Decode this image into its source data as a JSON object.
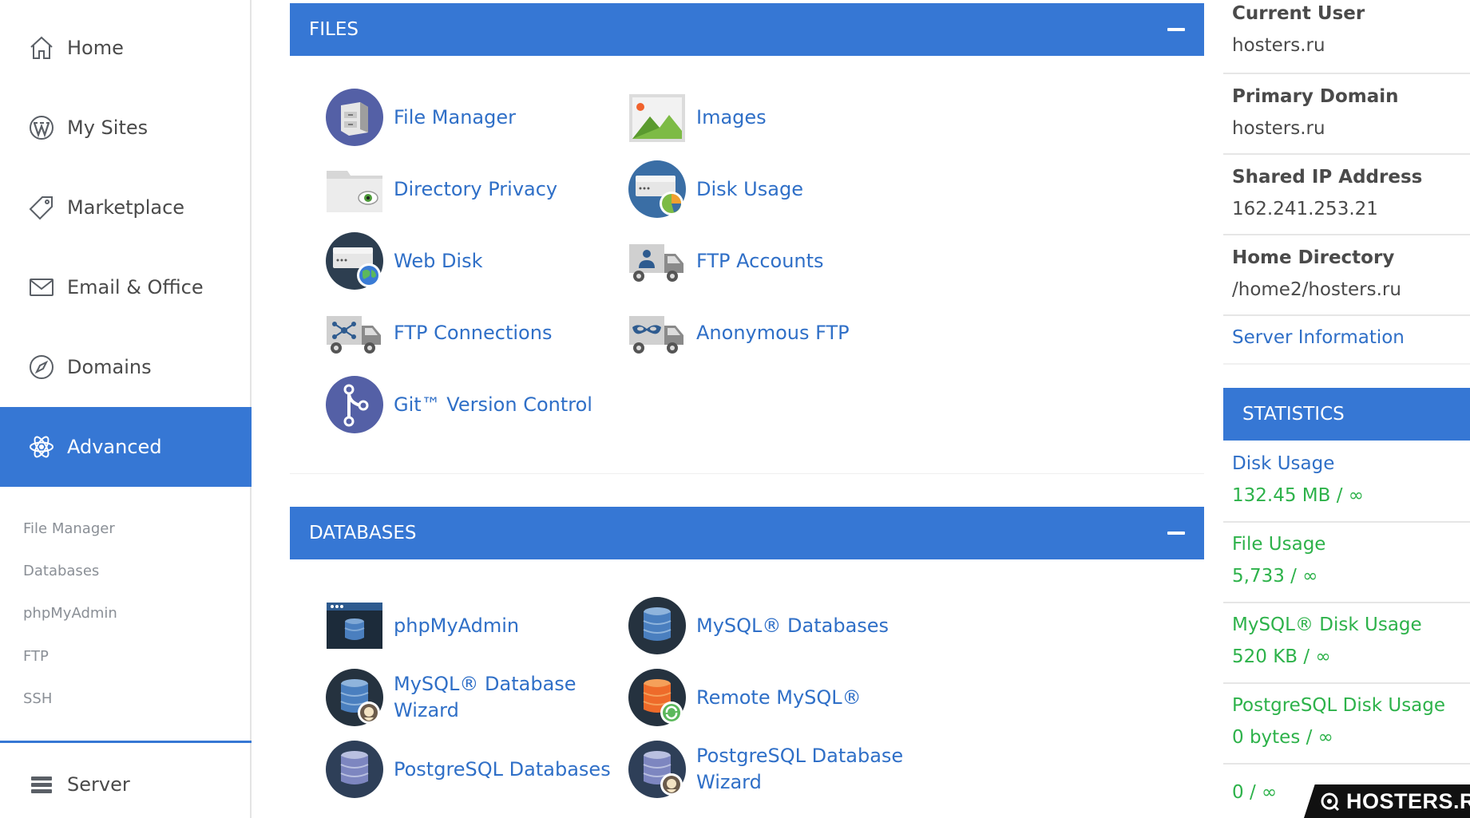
{
  "colors": {
    "accent": "#3677d4",
    "link": "#2f6fc7",
    "stat_green": "#2db24a",
    "text": "#4a4a4a",
    "subnav": "#8a8f96"
  },
  "sidebar": {
    "items": [
      {
        "label": "Home",
        "icon": "home-icon",
        "active": false
      },
      {
        "label": "My Sites",
        "icon": "wordpress-icon",
        "active": false
      },
      {
        "label": "Marketplace",
        "icon": "tag-icon",
        "active": false
      },
      {
        "label": "Email & Office",
        "icon": "envelope-icon",
        "active": false
      },
      {
        "label": "Domains",
        "icon": "compass-icon",
        "active": false
      },
      {
        "label": "Advanced",
        "icon": "atom-icon",
        "active": true
      }
    ],
    "subitems": [
      "File Manager",
      "Databases",
      "phpMyAdmin",
      "FTP",
      "SSH"
    ],
    "server": {
      "label": "Server",
      "icon": "server-stack-icon"
    }
  },
  "files": {
    "title": "FILES",
    "tools": [
      {
        "label": "File Manager",
        "icon": "file-cabinet-icon"
      },
      {
        "label": "Images",
        "icon": "image-icon"
      },
      {
        "label": "Directory Privacy",
        "icon": "folder-eye-icon"
      },
      {
        "label": "Disk Usage",
        "icon": "disk-usage-icon"
      },
      {
        "label": "Web Disk",
        "icon": "web-disk-icon"
      },
      {
        "label": "FTP Accounts",
        "icon": "ftp-accounts-truck-icon"
      },
      {
        "label": "FTP Connections",
        "icon": "ftp-connections-truck-icon"
      },
      {
        "label": "Anonymous FTP",
        "icon": "anonymous-ftp-truck-icon"
      },
      {
        "label": "Git™ Version Control",
        "icon": "git-icon"
      }
    ]
  },
  "databases": {
    "title": "DATABASES",
    "tools": [
      {
        "label": "phpMyAdmin",
        "icon": "phpmyadmin-icon"
      },
      {
        "label": "MySQL® Databases",
        "icon": "mysql-database-icon"
      },
      {
        "label": "MySQL® Database",
        "label2": "Wizard",
        "icon": "mysql-wizard-icon"
      },
      {
        "label": "Remote MySQL®",
        "icon": "remote-mysql-icon"
      },
      {
        "label": "PostgreSQL Databases",
        "icon": "postgresql-database-icon"
      },
      {
        "label": "PostgreSQL Database",
        "label2": "Wizard",
        "icon": "postgresql-wizard-icon"
      }
    ]
  },
  "account": {
    "current_user": {
      "label": "Current User",
      "value": "hosters.ru"
    },
    "primary_domain": {
      "label": "Primary Domain",
      "value": "hosters.ru"
    },
    "shared_ip": {
      "label": "Shared IP Address",
      "value": "162.241.253.21"
    },
    "home_directory": {
      "label": "Home Directory",
      "value": "/home2/hosters.ru"
    },
    "server_information": "Server Information"
  },
  "statistics": {
    "title": "STATISTICS",
    "items": [
      {
        "label": "Disk Usage",
        "value": "132.45 MB / ∞",
        "label_color": "#2f6fc7"
      },
      {
        "label": "File Usage",
        "value": "5,733 / ∞",
        "label_color": "#2db24a"
      },
      {
        "label": "MySQL® Disk Usage",
        "value": "520 KB / ∞",
        "label_color": "#2db24a"
      },
      {
        "label": "PostgreSQL Disk Usage",
        "value": "0 bytes / ∞",
        "label_color": "#2db24a"
      },
      {
        "label": "",
        "value": "0 / ∞",
        "label_color": "#2db24a"
      }
    ]
  },
  "watermark": "HOSTERS.RU"
}
